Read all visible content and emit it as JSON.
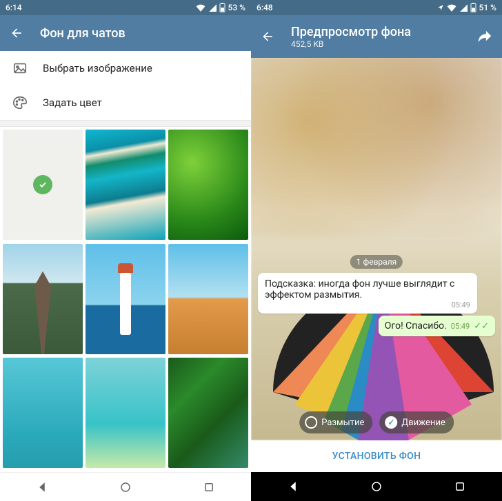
{
  "left": {
    "status": {
      "time": "6:14",
      "battery": "53 %"
    },
    "appbar": {
      "title": "Фон для чатов"
    },
    "menu": {
      "choose_image": "Выбрать изображение",
      "set_color": "Задать цвет"
    }
  },
  "right": {
    "status": {
      "time": "6:48",
      "battery": "51 %"
    },
    "appbar": {
      "title": "Предпросмотр фона",
      "subtitle": "452,5 KB"
    },
    "date_chip": "1 февраля",
    "bubble_in": {
      "text": "Подсказка: иногда фон лучше выглядит с эффектом размытия.",
      "time": "05:49"
    },
    "bubble_out": {
      "text": "Ого! Спасибо.",
      "time": "05:49"
    },
    "options": {
      "blur": "Размытие",
      "motion": "Движение"
    },
    "apply": "УСТАНОВИТЬ ФОН"
  }
}
